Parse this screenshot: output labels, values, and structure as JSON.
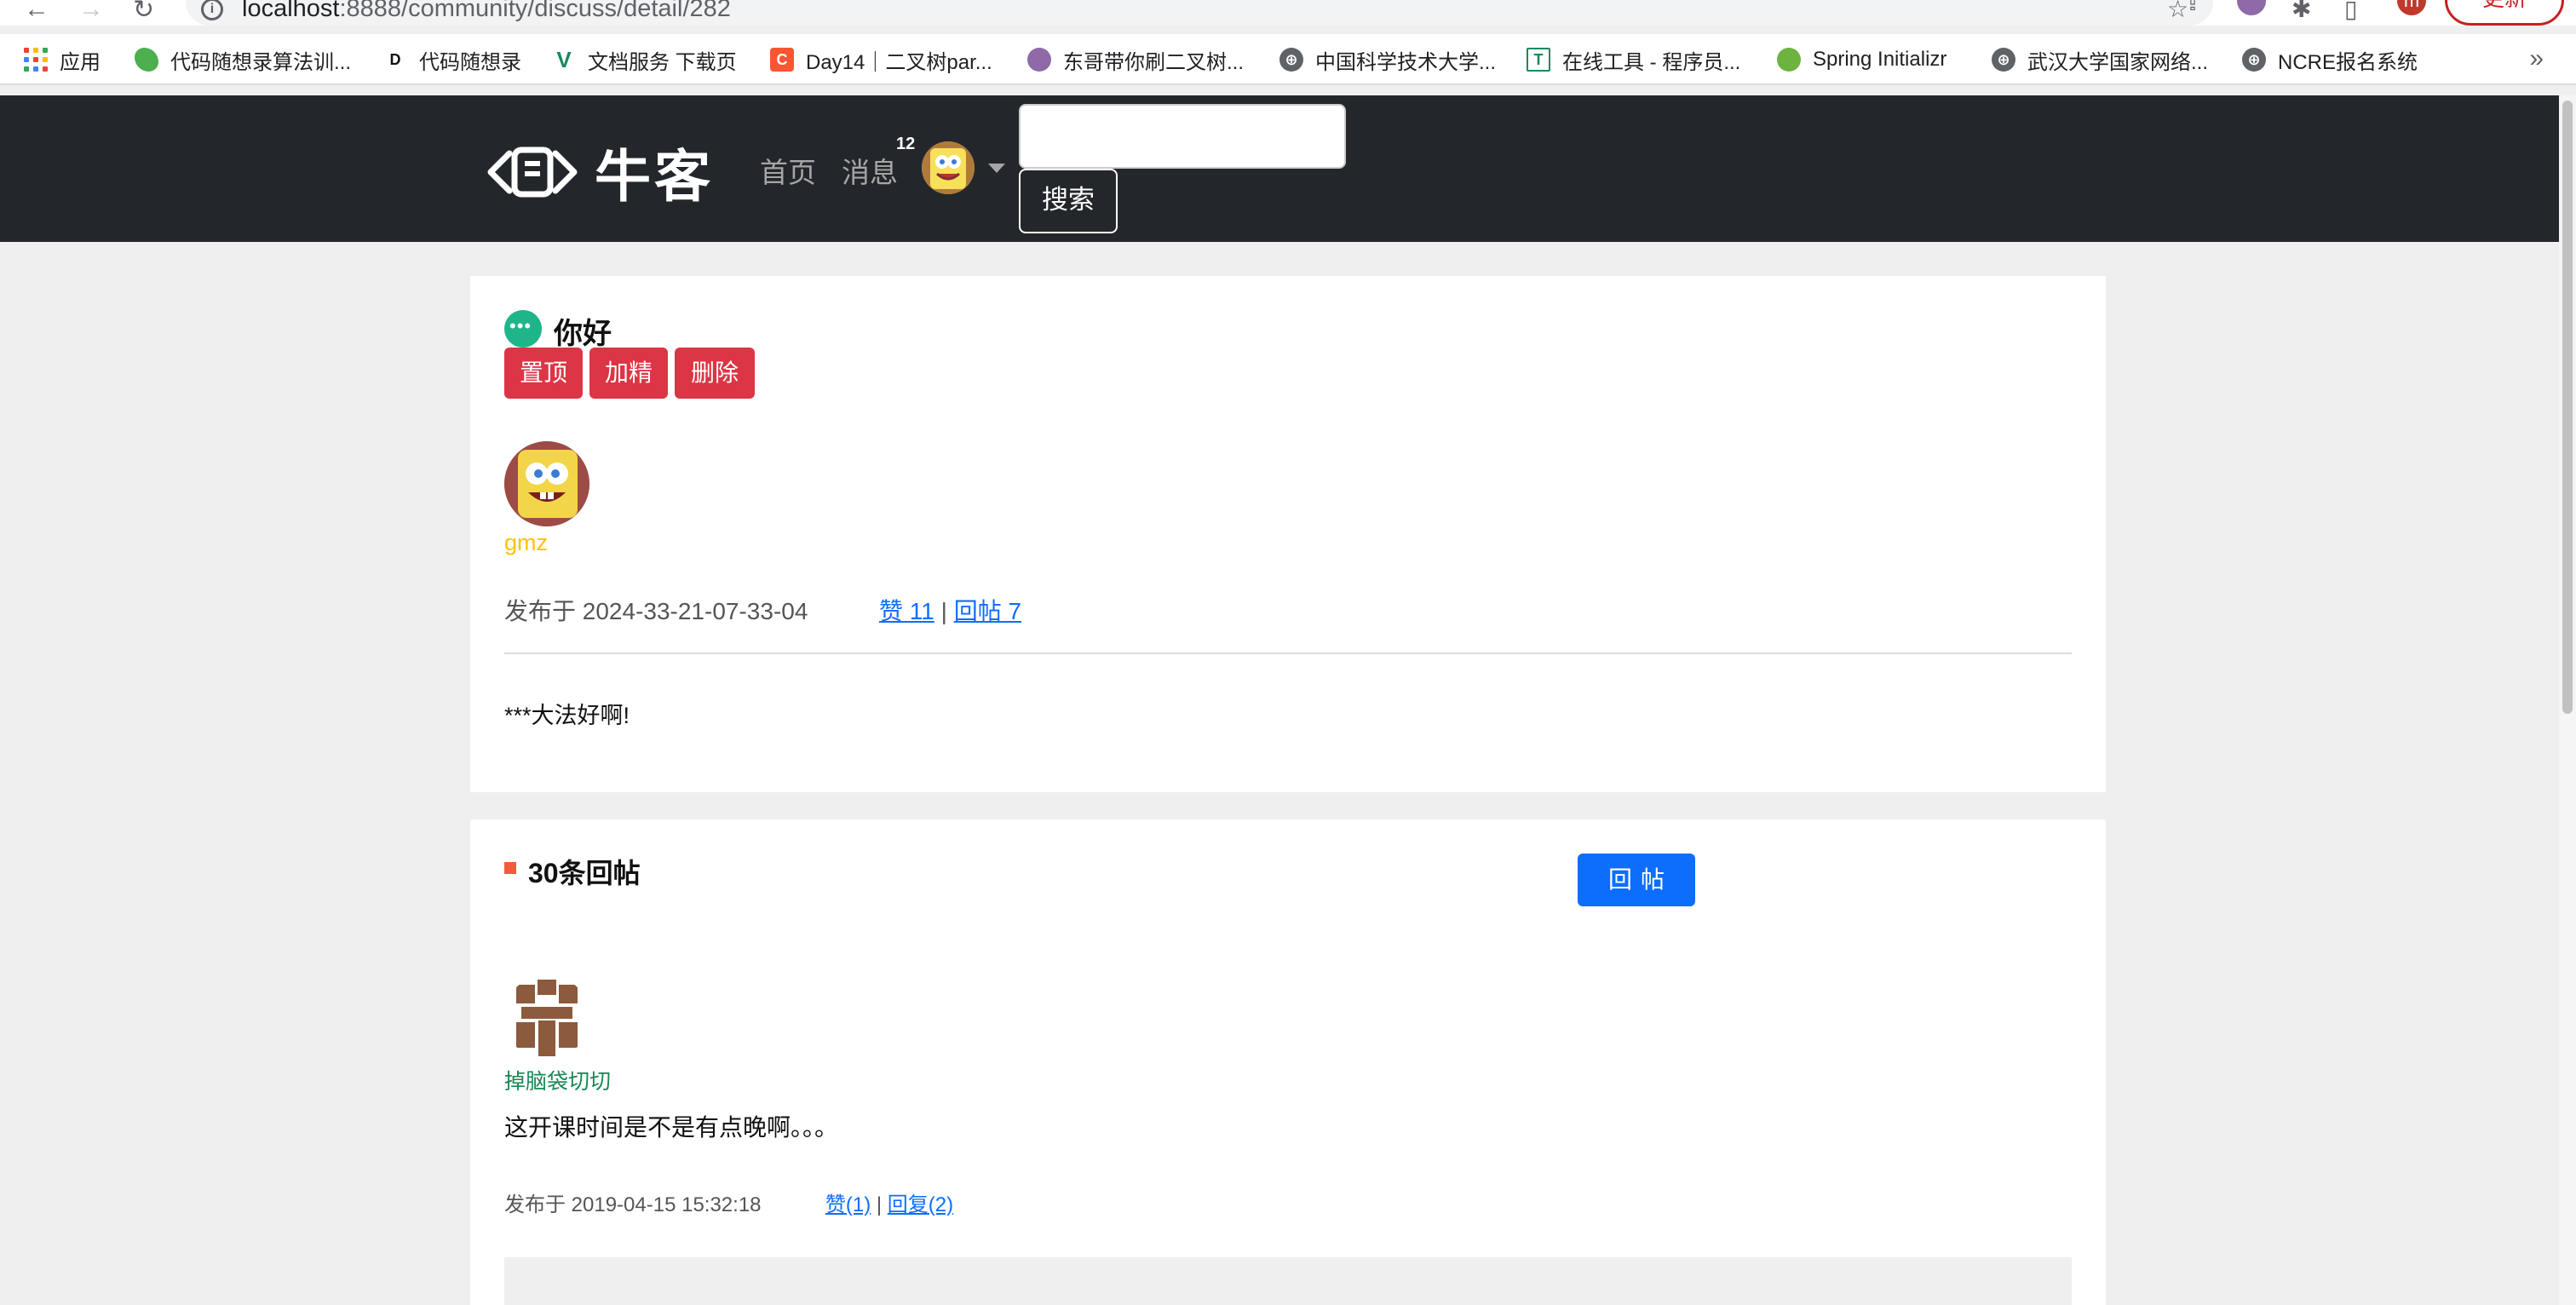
{
  "browser": {
    "url_host": "localhost",
    "url_path": ":8888/community/discuss/detail/282",
    "update_label": "更新",
    "profile_initial": "m",
    "bookmarks": [
      {
        "label": "应用"
      },
      {
        "label": "代码随想录算法训..."
      },
      {
        "label": "代码随想录"
      },
      {
        "label": "文档服务 下载页"
      },
      {
        "label": "Day14｜二叉树par..."
      },
      {
        "label": "东哥带你刷二叉树..."
      },
      {
        "label": "中国科学技术大学..."
      },
      {
        "label": "在线工具 - 程序员..."
      },
      {
        "label": "Spring Initializr"
      },
      {
        "label": "武汉大学国家网络..."
      },
      {
        "label": "NCRE报名系统"
      }
    ],
    "more_label": "»"
  },
  "header": {
    "logo_text": "牛客",
    "nav_home": "首页",
    "nav_messages": "消息",
    "message_count": "12",
    "search_placeholder": "",
    "search_label": "搜索"
  },
  "post": {
    "title": "你好",
    "actions": {
      "top": "置顶",
      "wonderful": "加精",
      "delete": "删除"
    },
    "author": "gmz",
    "published_prefix": "发布于 2024-33-21-07-33-04",
    "like_label": "赞 11",
    "separator": "|",
    "reply_label": "回帖 7",
    "content": "***大法好啊!"
  },
  "replies": {
    "count_label": "30条回帖",
    "reply_button": "回帖",
    "items": [
      {
        "user": "掉脑袋切切",
        "content": "这开课时间是不是有点晚啊。。。",
        "published": "发布于 2019-04-15 15:32:18",
        "like_label": "赞(1)",
        "separator": "|",
        "reply_label": "回复(2)"
      }
    ]
  },
  "colors": {
    "header_bg": "#23272b",
    "danger": "#dc3545",
    "primary": "#0d6efd",
    "author_name": "#ffc107",
    "replier_name": "#198754"
  }
}
